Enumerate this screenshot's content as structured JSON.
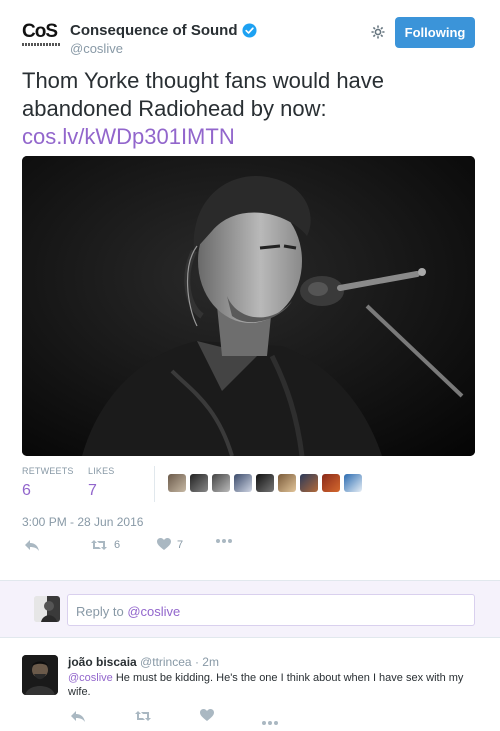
{
  "account": {
    "name": "Consequence of Sound",
    "handle": "@coslive",
    "logo_text": "CoS",
    "follow_label": "Following"
  },
  "tweet": {
    "text": "Thom Yorke thought fans would have abandoned Radiohead by now:",
    "link": "cos.lv/kWDp301IMTN",
    "retweets_label": "RETWEETS",
    "retweets_count": "6",
    "likes_label": "LIKES",
    "likes_count": "7",
    "timestamp": "3:00 PM - 28 Jun 2016",
    "action_retweet_count": "6",
    "action_like_count": "7"
  },
  "reply_box": {
    "placeholder_prefix": "Reply to ",
    "mention": "@coslive"
  },
  "reply": {
    "name": "joão biscaia",
    "handle": "@ttrincea",
    "age": "· 2m",
    "mention": "@coslive",
    "text": " He must be kidding. He's the one I think about when I have sex with my wife."
  },
  "colors": {
    "accent": "#9266cc",
    "follow_button": "#3b94d9",
    "verified": "#1da1f2",
    "muted": "#8899a6"
  },
  "icons": [
    "settings-gear-icon",
    "verified-badge-icon",
    "reply-icon",
    "retweet-icon",
    "like-heart-icon",
    "more-dots-icon"
  ]
}
